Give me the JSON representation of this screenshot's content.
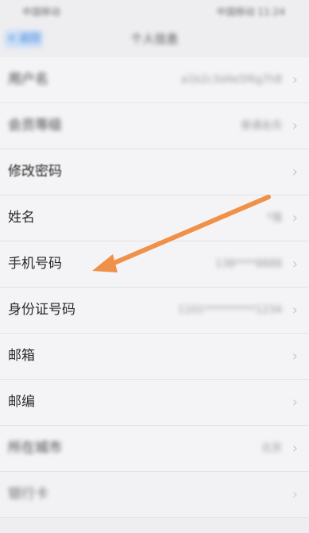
{
  "status_bar": {
    "left": "中国移动",
    "right": "中国移动 11:24"
  },
  "nav": {
    "back_label": "< 返回",
    "title": "个人信息"
  },
  "rows": [
    {
      "label": "用户名",
      "value": "a1b2c3d4e5f6g7h8"
    },
    {
      "label": "会员等级",
      "value": "普通会员"
    },
    {
      "label": "修改密码",
      "value": ""
    },
    {
      "label": "姓名",
      "value": "*强"
    },
    {
      "label": "手机号码",
      "value": "138****8888"
    },
    {
      "label": "身份证号码",
      "value": "1101**********1234"
    },
    {
      "label": "邮箱",
      "value": ""
    },
    {
      "label": "邮编",
      "value": ""
    },
    {
      "label": "所在城市",
      "value": "北京"
    },
    {
      "label": "银行卡",
      "value": ""
    }
  ],
  "annotation": {
    "arrow_color": "#f0914a"
  }
}
